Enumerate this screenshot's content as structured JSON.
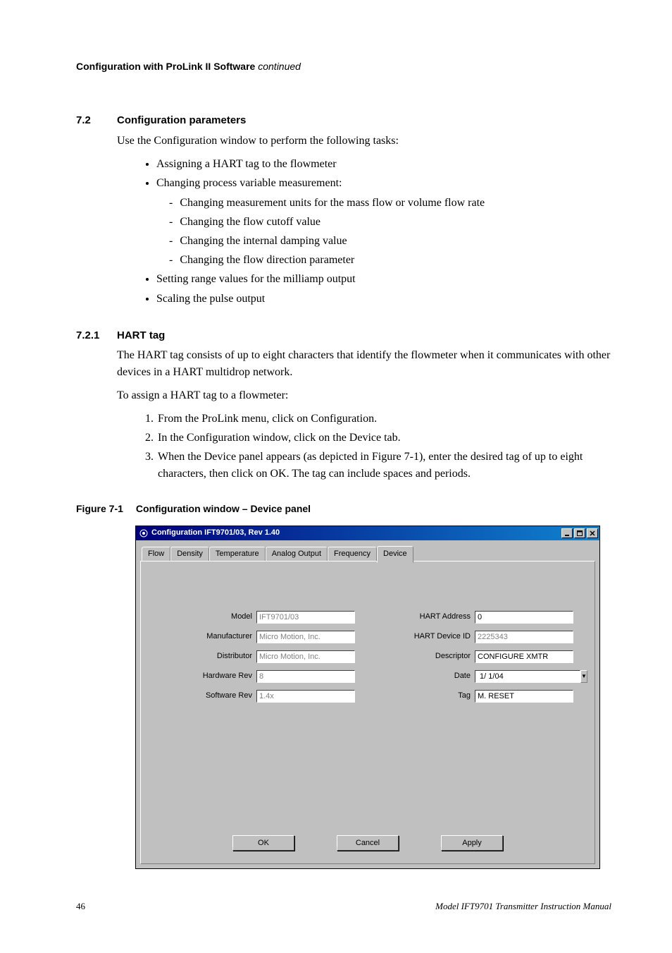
{
  "header": {
    "title": "Configuration with ProLink II Software",
    "continued": "continued"
  },
  "sec72": {
    "num": "7.2",
    "title": "Configuration parameters",
    "intro": "Use the Configuration window to perform the following tasks:",
    "b1": "Assigning a HART tag to the flowmeter",
    "b2": "Changing process variable measurement:",
    "b2a": "Changing measurement units for the mass flow or volume flow rate",
    "b2b": "Changing the flow cutoff value",
    "b2c": "Changing the internal damping value",
    "b2d": "Changing the flow direction parameter",
    "b3": "Setting range values for the milliamp output",
    "b4": "Scaling the pulse output"
  },
  "sec721": {
    "num": "7.2.1",
    "title": "HART tag",
    "p1": "The HART tag consists of up to eight characters that identify the flowmeter when it communicates with other devices in a HART multidrop network.",
    "p2": "To assign a HART tag to a flowmeter:",
    "s1": "From the ProLink menu, click on Configuration.",
    "s2": "In the Configuration window, click on the Device tab.",
    "s3": "When the Device panel appears (as depicted in Figure 7-1), enter the desired tag of up to eight characters, then click on OK. The tag can include spaces and periods."
  },
  "figure": {
    "label": "Figure 7-1",
    "caption": "Configuration window – Device panel"
  },
  "window": {
    "title": "Configuration IFT9701/03, Rev 1.40",
    "tabs": {
      "t0": "Flow",
      "t1": "Density",
      "t2": "Temperature",
      "t3": "Analog Output",
      "t4": "Frequency",
      "t5": "Device"
    },
    "labels": {
      "model": "Model",
      "manufacturer": "Manufacturer",
      "distributor": "Distributor",
      "hwrev": "Hardware Rev",
      "swrev": "Software Rev",
      "hartaddr": "HART Address",
      "hartdev": "HART Device ID",
      "descriptor": "Descriptor",
      "date": "Date",
      "tag": "Tag"
    },
    "values": {
      "model": "IFT9701/03",
      "manufacturer": "Micro Motion, Inc.",
      "distributor": "Micro Motion, Inc.",
      "hwrev": "8",
      "swrev": "1.4x",
      "hartaddr": "0",
      "hartdev": "2225343",
      "descriptor": "CONFIGURE XMTR",
      "date": " 1/ 1/04",
      "tag": "M. RESET"
    },
    "buttons": {
      "ok": "OK",
      "cancel": "Cancel",
      "apply": "Apply"
    }
  },
  "footer": {
    "page": "46",
    "doc": "Model IFT9701 Transmitter Instruction Manual"
  }
}
